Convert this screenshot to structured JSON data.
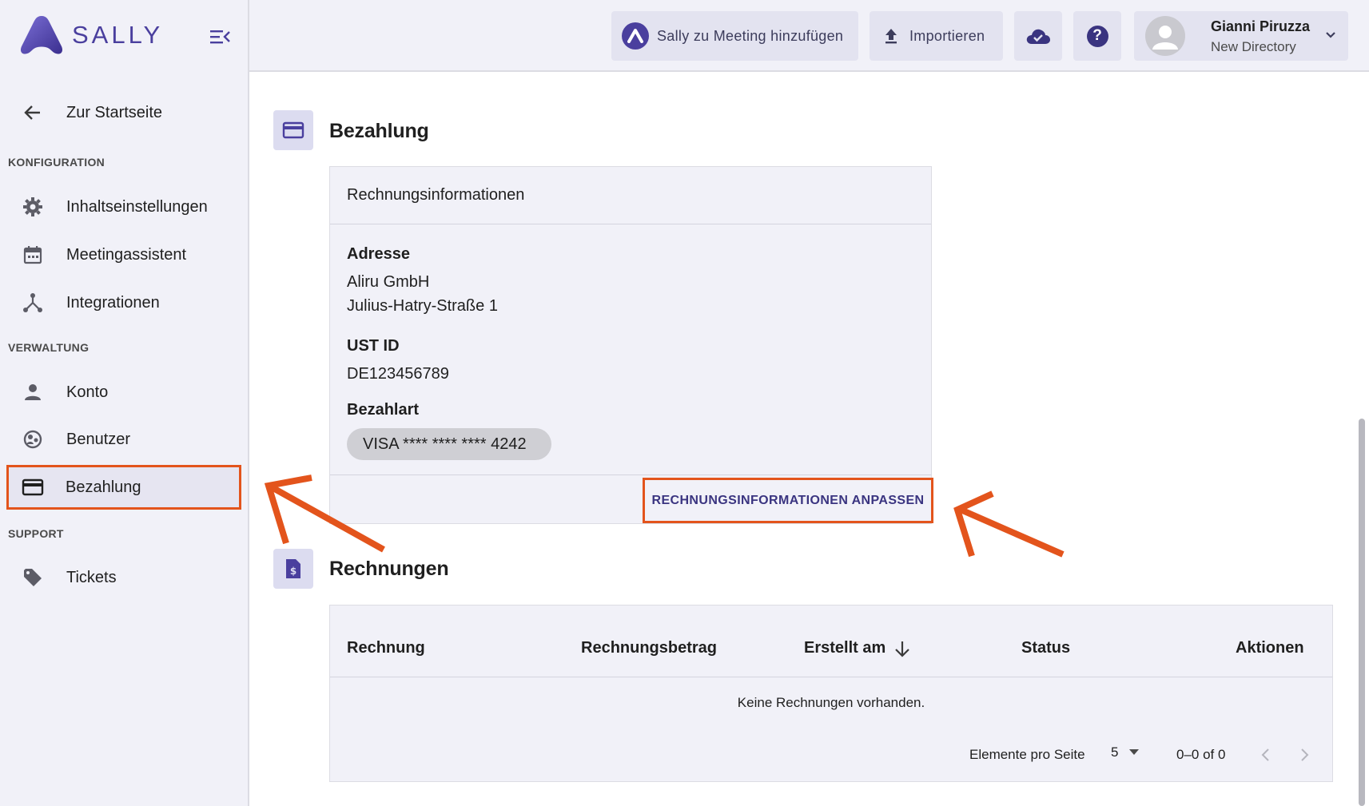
{
  "brand": {
    "name": "SALLY",
    "accent": "#4a3f9e",
    "highlight": "#e3541c"
  },
  "sidebar": {
    "back_label": "Zur Startseite",
    "sections": {
      "konfiguration": "KONFIGURATION",
      "verwaltung": "VERWALTUNG",
      "support": "SUPPORT"
    },
    "items": {
      "inhalt": "Inhaltseinstellungen",
      "meeting": "Meetingassistent",
      "integrationen": "Integrationen",
      "konto": "Konto",
      "benutzer": "Benutzer",
      "bezahlung": "Bezahlung",
      "tickets": "Tickets"
    }
  },
  "topbar": {
    "add_meeting": "Sally zu Meeting hinzufügen",
    "import": "Importieren",
    "user_name": "Gianni Piruzza",
    "user_directory": "New Directory"
  },
  "payment": {
    "title": "Bezahlung",
    "card_title": "Rechnungsinformationen",
    "address_label": "Adresse",
    "address_line1": "Aliru GmbH",
    "address_line2": "Julius-Hatry-Straße 1",
    "ust_label": "UST ID",
    "ust_value": "DE123456789",
    "method_label": "Bezahlart",
    "method_value": "VISA **** **** **** 4242",
    "adjust_button": "RECHNUNGSINFORMATIONEN ANPASSEN"
  },
  "invoices": {
    "title": "Rechnungen",
    "columns": {
      "invoice": "Rechnung",
      "amount": "Rechnungsbetrag",
      "created": "Erstellt am",
      "status": "Status",
      "actions": "Aktionen"
    },
    "empty_text": "Keine Rechnungen vorhanden.",
    "per_page_label": "Elemente pro Seite",
    "per_page_value": "5",
    "range_text": "0–0 of 0"
  }
}
